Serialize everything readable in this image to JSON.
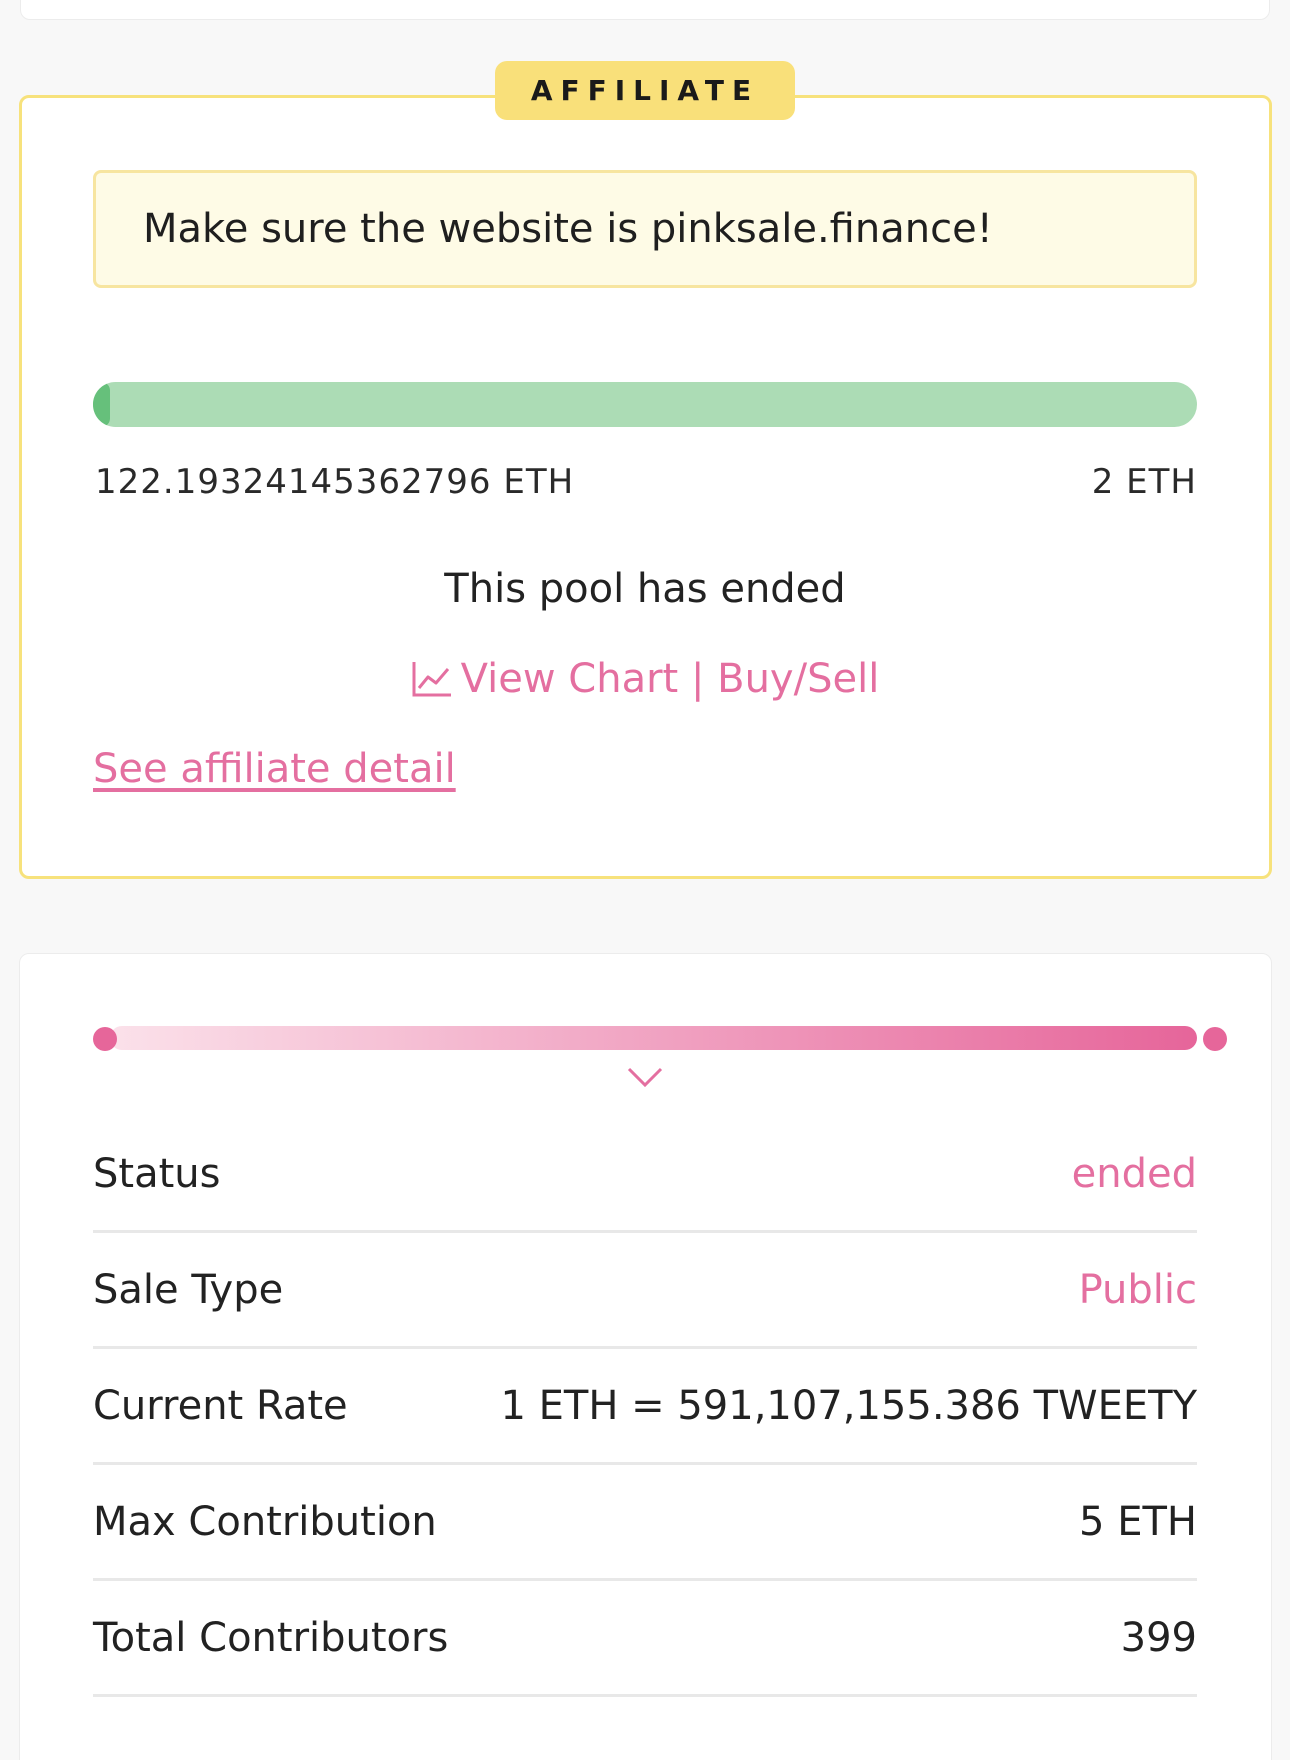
{
  "affiliate": {
    "badge": "AFFILIATE",
    "warning": "Make sure the website is pinksale.finance!",
    "progress_percent": 1.5,
    "raised": "122.19324145362796 ETH",
    "target": "2 ETH",
    "status_message": "This pool has ended",
    "chart_link": "View Chart | Buy/Sell",
    "affiliate_link": "See affiliate detail"
  },
  "details": {
    "rows": [
      {
        "label": "Status",
        "value": "ended"
      },
      {
        "label": "Sale Type",
        "value": "Public"
      },
      {
        "label": "Current Rate",
        "value": "1 ETH = 591,107,155.386 TWEETY"
      },
      {
        "label": "Max Contribution",
        "value": "5 ETH"
      },
      {
        "label": "Total Contributors",
        "value": "399"
      }
    ]
  },
  "colors": {
    "accent_pink": "#e46fa0",
    "badge_yellow": "#f9e07a",
    "progress_green": "#acdcb5"
  }
}
